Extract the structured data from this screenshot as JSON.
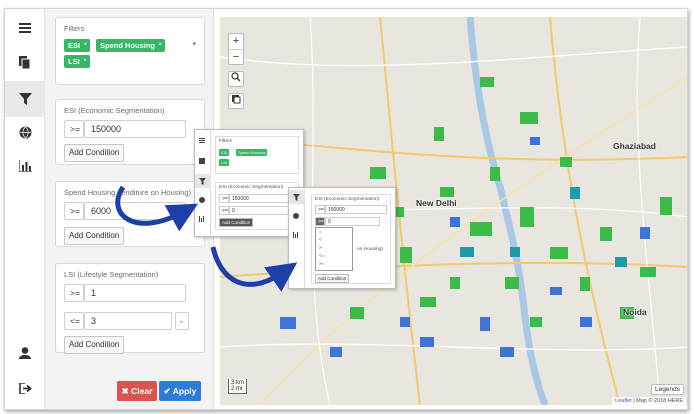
{
  "sidebar_icons": [
    "menu-icon",
    "documents-icon",
    "filter-icon",
    "globe-icon",
    "bar-chart-icon",
    "user-icon",
    "logout-icon"
  ],
  "filters": {
    "title": "Filters",
    "tags": [
      "ESI",
      "Spend Housing",
      "LSI"
    ],
    "remove_glyph": "×",
    "caret": "▾"
  },
  "esi": {
    "title": "ESI (Economic Segmentation)",
    "operator": ">=",
    "value": "150000",
    "add_label": "Add Condition"
  },
  "spend": {
    "title_visible_start": "Spend Housing",
    "title_visible_end": "enditure on Housing)",
    "operator": ">=",
    "value": "6000",
    "add_label": "Add Condition"
  },
  "lsi": {
    "title": "LSI (Lifestyle Segmentation)",
    "conditions": [
      {
        "operator": ">=",
        "value": "1"
      },
      {
        "operator": "<=",
        "value": "3",
        "remove": "-"
      }
    ],
    "add_label": "Add Condition"
  },
  "actions": {
    "clear_label": "Clear",
    "clear_icon": "✖",
    "apply_label": "Apply",
    "apply_icon": "✔"
  },
  "map": {
    "zoom_in": "+",
    "zoom_out": "−",
    "city_labels": [
      "New Delhi",
      "Ghaziabad",
      "Noida"
    ],
    "scale_km": "3 km",
    "scale_mi": "2 mi",
    "legends_label": "Legends",
    "attribution_link": "Leaflet",
    "attribution_text": "| Map © 2018 HERE",
    "colors": {
      "green": "#3dbb4a",
      "blue": "#3d74d6",
      "teal": "#1f9aa8",
      "land": "#e9e6df"
    }
  },
  "inset1": {
    "filters_title": "Filters",
    "tags": [
      "ESI",
      "Spend Housing",
      "LSI"
    ],
    "esi_title": "ESI (Economic Segmentation)",
    "operator": ">=",
    "value": "150000",
    "value2": "0",
    "add_label": "Add Condition"
  },
  "inset2": {
    "esi_title": "ESI (Economic Segmentation)",
    "operator": ">=",
    "value": "150000",
    "value2": "0",
    "dropdown_options": [
      "=",
      "<",
      ">",
      "<=",
      ">="
    ],
    "side_text": "on Housing)",
    "add_label": "Add Condition"
  }
}
